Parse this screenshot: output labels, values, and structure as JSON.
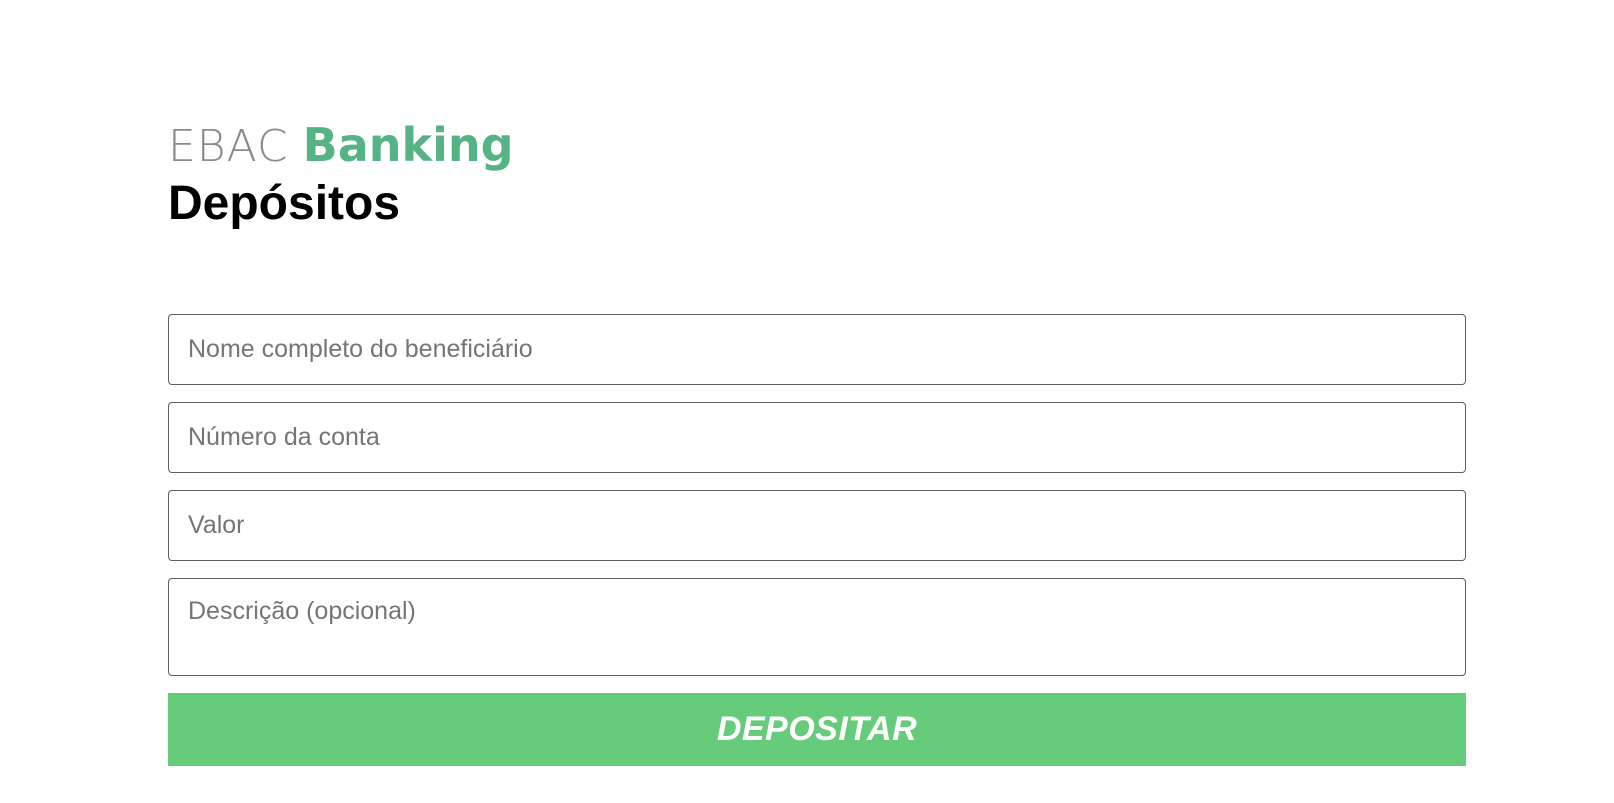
{
  "brand": {
    "light": "EBAC",
    "bold": "Banking",
    "accent_color": "#55b384"
  },
  "page": {
    "title": "Depósitos"
  },
  "form": {
    "beneficiary_placeholder": "Nome completo do beneficiário",
    "account_placeholder": "Número da conta",
    "amount_placeholder": "Valor",
    "description_placeholder": "Descrição (opcional)",
    "submit_label": "DEPOSITAR",
    "submit_color": "#66cb7a"
  }
}
